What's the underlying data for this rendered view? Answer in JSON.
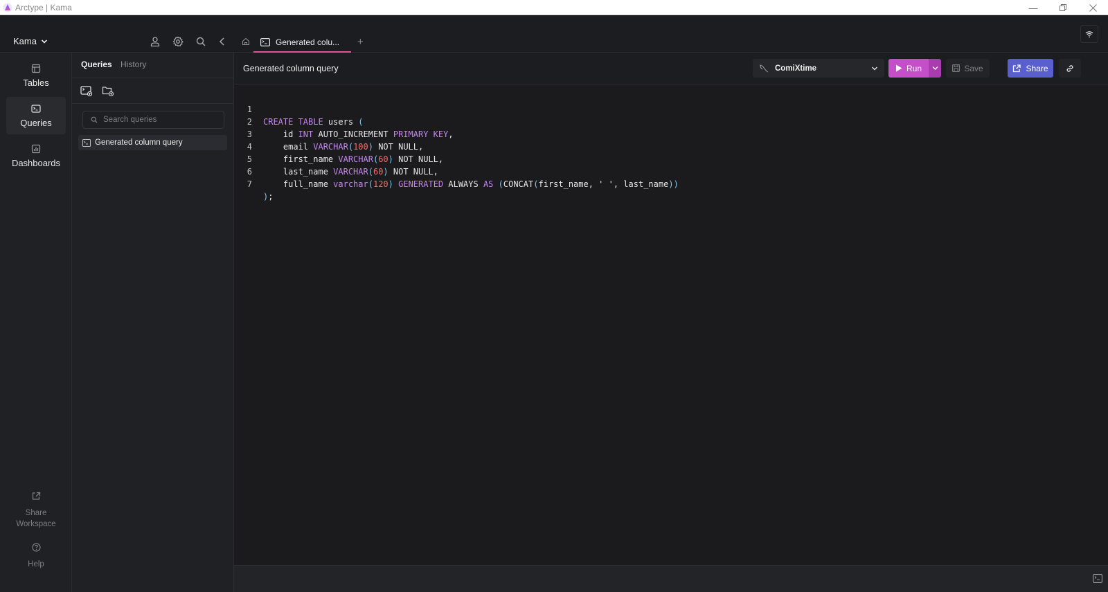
{
  "window": {
    "title": "Arctype | Kama",
    "controls": [
      "minimize",
      "restore",
      "close"
    ]
  },
  "workspace": {
    "name": "Kama",
    "header_icons": [
      "user-icon",
      "gear-icon",
      "search-icon",
      "collapse-icon"
    ]
  },
  "rail": {
    "items": [
      {
        "label": "Tables",
        "icon": "table-icon",
        "active": false
      },
      {
        "label": "Queries",
        "icon": "terminal-icon",
        "active": true
      },
      {
        "label": "Dashboards",
        "icon": "chart-icon",
        "active": false
      }
    ],
    "bottom": [
      {
        "label": "Share Workspace",
        "icon": "external-link-icon"
      },
      {
        "label": "Help",
        "icon": "help-icon"
      }
    ]
  },
  "query_panel": {
    "tabs": [
      {
        "label": "Queries",
        "active": true
      },
      {
        "label": "History",
        "active": false
      }
    ],
    "tools": [
      "new-query-icon",
      "new-folder-icon"
    ],
    "search": {
      "placeholder": "Search queries",
      "value": ""
    },
    "items": [
      {
        "label": "Generated column query",
        "selected": true
      }
    ]
  },
  "tabs": {
    "items": [
      {
        "label": "Generated colu...",
        "active": true
      }
    ],
    "add_label": "+"
  },
  "toolbar": {
    "query_title": "Generated column query",
    "connection": "ComiXtime",
    "run_label": "Run",
    "save_label": "Save",
    "share_label": "Share"
  },
  "editor": {
    "lines": [
      "CREATE TABLE users (",
      "    id INT AUTO_INCREMENT PRIMARY KEY,",
      "    email VARCHAR(100) NOT NULL,",
      "    first_name VARCHAR(60) NOT NULL,",
      "    last_name VARCHAR(60) NOT NULL,",
      "    full_name varchar(120) GENERATED ALWAYS AS (CONCAT(first_name, ' ', last_name))",
      ");"
    ]
  },
  "colors": {
    "accent_tab": "#e0569e",
    "run": "#c44fc9",
    "share": "#5a5fce",
    "keyword": "#c386f1",
    "number": "#f46c6c",
    "paren": "#7fc6f2"
  }
}
